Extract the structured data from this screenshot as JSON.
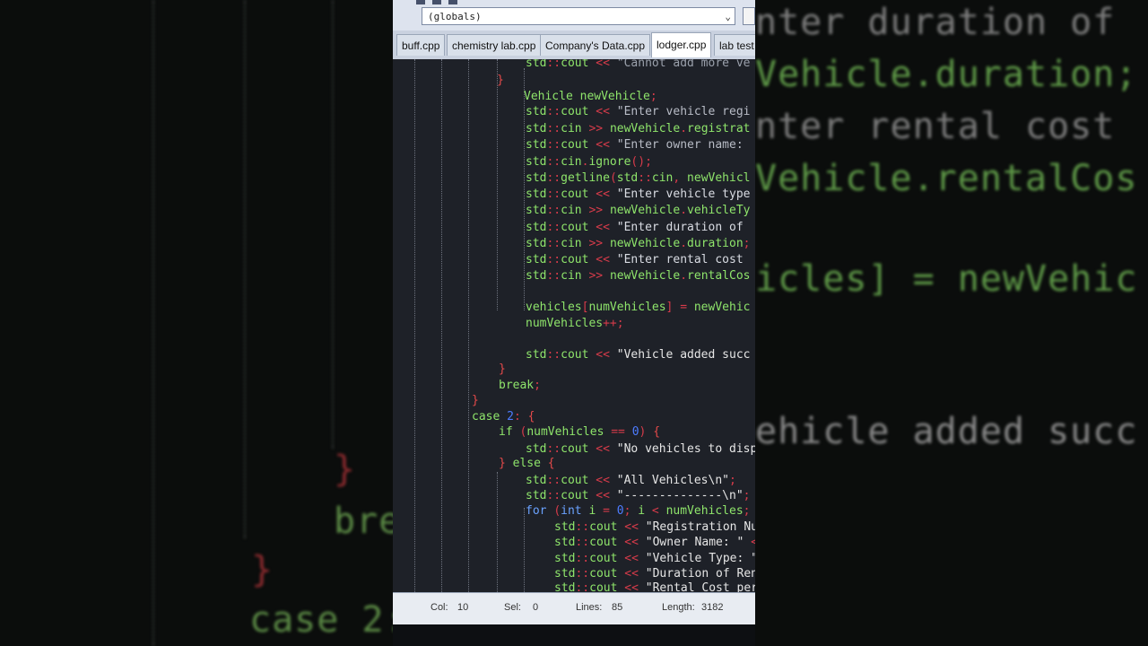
{
  "toolbar": {
    "scope_select_value": "(globals)"
  },
  "tabs": [
    {
      "label": "buff.cpp"
    },
    {
      "label": "chemistry lab.cpp"
    },
    {
      "label": "Company's Data.cpp"
    },
    {
      "label": "lodger.cpp"
    },
    {
      "label": "lab test"
    }
  ],
  "code": [
    "std::cout << \"Cannot add more ve",
    "}",
    "Vehicle newVehicle;",
    "std::cout << \"Enter vehicle regi",
    "std::cin >> newVehicle.registrat",
    "std::cout << \"Enter owner name: ",
    "std::cin.ignore();",
    "std::getline(std::cin, newVehicl",
    "std::cout << \"Enter vehicle type",
    "std::cin >> newVehicle.vehicleTy",
    "std::cout << \"Enter duration of ",
    "std::cin >> newVehicle.duration;",
    "std::cout << \"Enter rental cost ",
    "std::cin >> newVehicle.rentalCos",
    "vehicles[numVehicles] = newVehic",
    "numVehicles++;",
    "std::cout << \"Vehicle added succ",
    "}",
    "break;",
    "}",
    "case 2: {",
    "if (numVehicles == 0) {",
    "std::cout << \"No vehicles to disp",
    "} else {",
    "std::cout << \"All Vehicles\\n\";",
    "std::cout << \"--------------\\n\";",
    "for (int i = 0; i < numVehicles;",
    "std::cout << \"Registration Nu",
    "std::cout << \"Owner Name: \" <",
    "std::cout << \"Vehicle Type: \"",
    "std::cout << \"Duration of Ren",
    "std::cout << \"Rental Cost per"
  ],
  "status": {
    "col_label": "Col:",
    "col_value": "10",
    "sel_label": "Sel:",
    "sel_value": "0",
    "lines_label": "Lines:",
    "lines_value": "85",
    "length_label": "Length:",
    "length_value": "3182"
  },
  "background_left": [
    "}",
    "bre",
    "}",
    "case 2:"
  ],
  "background_right": [
    "nter duration of",
    "Vehicle.duration;",
    "nter rental cost",
    "Vehicle.rentalCos",
    "icles] = newVehic",
    "ehicle added succ"
  ],
  "colors": {
    "keyword_green": "#8fe56b",
    "string_text": "#d9dce3",
    "operator_red": "#d73b4a",
    "number_blue": "#4d7cff",
    "editor_bg": "#1e2128"
  }
}
